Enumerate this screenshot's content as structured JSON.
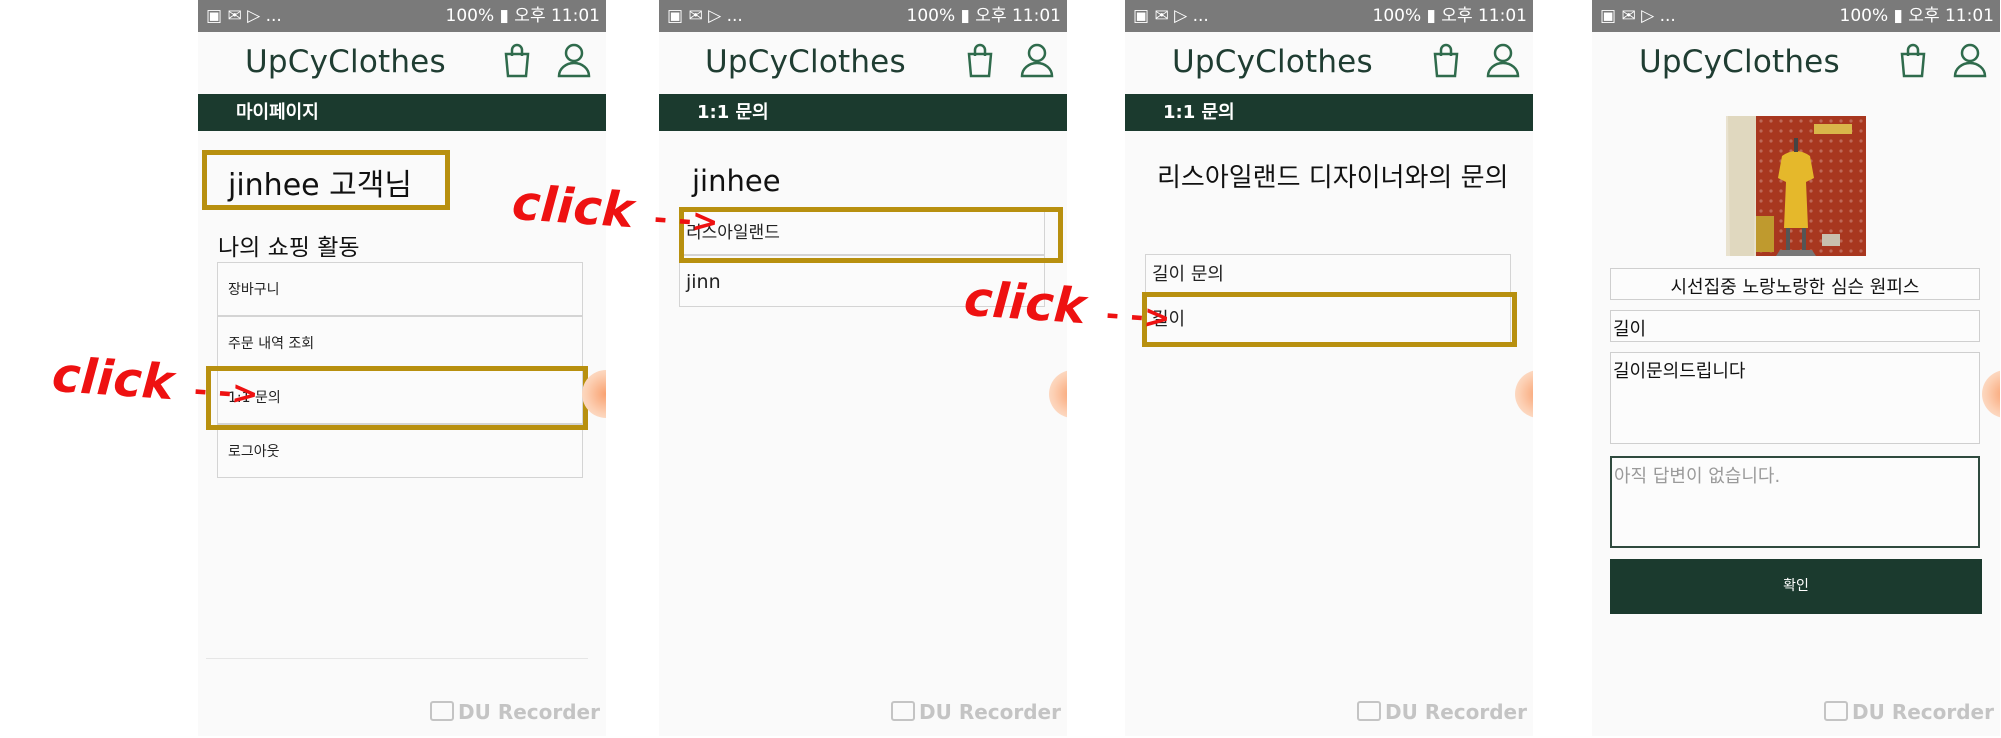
{
  "status_bar": {
    "left": "▣ ✉ ▷ ...",
    "right": "100% ▮ 오후 11:01"
  },
  "brand": "UpCyClothes",
  "recorder": "DU Recorder",
  "annotation": {
    "click": "click",
    "arrow": "- ->"
  },
  "screen1": {
    "bar_title": "마이페이지",
    "greeting": "jinhee 고객님",
    "section_title": "나의 쇼핑 활동",
    "menu": [
      "장바구니",
      "주문 내역 조회",
      "1:1 문의",
      "로그아웃"
    ]
  },
  "screen2": {
    "bar_title": "1:1 문의",
    "user": "jinhee",
    "items": [
      "리스아일랜드",
      "jinn"
    ]
  },
  "screen3": {
    "bar_title": "1:1 문의",
    "title": "리스아일랜드 디자이너와의 문의",
    "items": [
      "길이 문의",
      "길이"
    ]
  },
  "screen4": {
    "product_name": "시선집중 노랑노랑한 심슨 원피스",
    "subject": "길이",
    "message": "길이문의드립니다",
    "answer_placeholder": "아직 답변이 없습니다.",
    "confirm": "확인"
  },
  "colors": {
    "primary": "#1b3a2e",
    "highlight": "#b8900f",
    "annotation": "#ee1111"
  },
  "icons": [
    "shopping-bag-icon",
    "user-icon",
    "camera-icon",
    "floating-action-button"
  ]
}
